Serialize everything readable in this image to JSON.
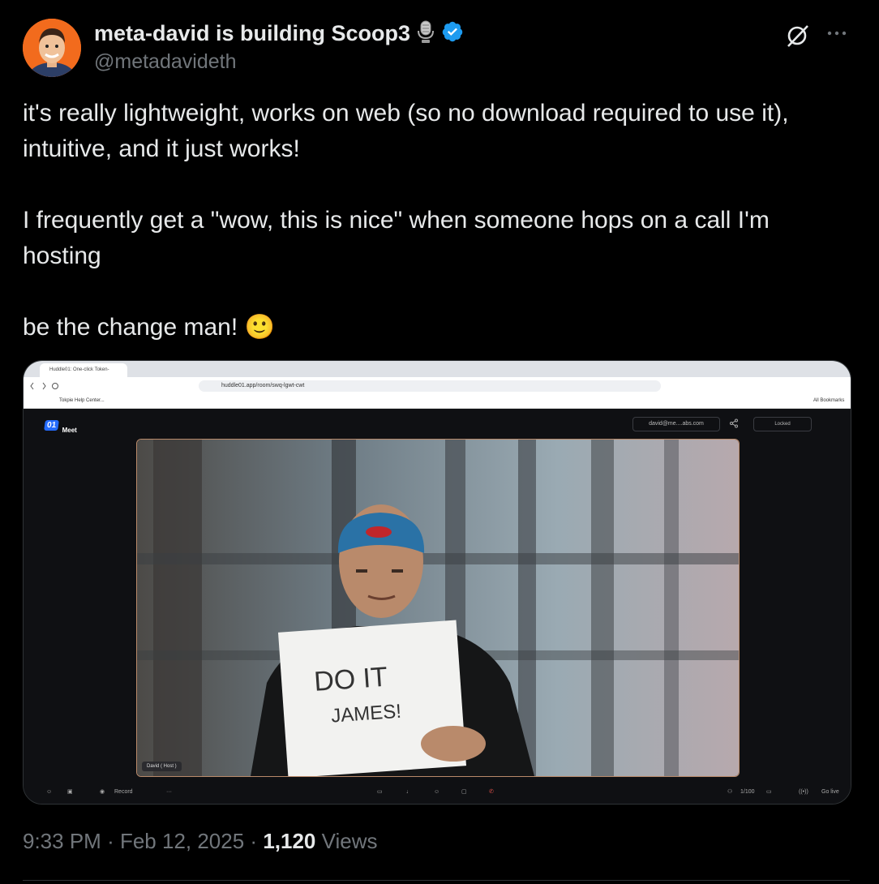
{
  "author": {
    "display_name": "meta-david is building Scoop3",
    "handle": "@metadavideth",
    "verified": true,
    "avatar_bg": "#f26b1d"
  },
  "tweet": {
    "text": "it's really lightweight, works on web (so no download required to use it), intuitive, and it just works!\n\nI frequently get a \"wow, this is nice\" when someone hops on a call I'm hosting\n\nbe the change man! 🙂",
    "time": "9:33 PM",
    "date": "Feb 12, 2025",
    "views_count": "1,120",
    "views_label": "Views"
  },
  "screenshot": {
    "tab_title": "Huddle01: One-click Token-",
    "url": "huddle01.app/room/swq-lgwt-cwt",
    "bookmark": "Tokpie Help Center...",
    "all_bookmarks": "All Bookmarks",
    "logo_badge": "01",
    "logo_text": "Meet",
    "email": "david@me....abs.com",
    "locked": "Locked",
    "participant_label": "David ( Host )",
    "sign_line1": "DO IT",
    "sign_line2": "JAMES!",
    "record": "Record",
    "participants": "1/100",
    "go_live": "Go live"
  },
  "colors": {
    "verified": "#1d9bf0",
    "muted": "#71767b",
    "accent_border": "#b98a6a"
  }
}
